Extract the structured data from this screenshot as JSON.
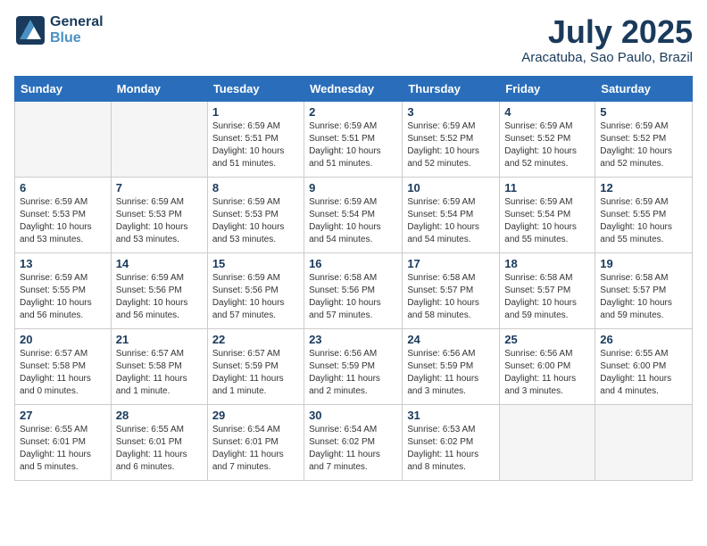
{
  "header": {
    "logo_general": "General",
    "logo_blue": "Blue",
    "month_title": "July 2025",
    "location": "Aracatuba, Sao Paulo, Brazil"
  },
  "weekdays": [
    "Sunday",
    "Monday",
    "Tuesday",
    "Wednesday",
    "Thursday",
    "Friday",
    "Saturday"
  ],
  "weeks": [
    [
      {
        "day": "",
        "info": ""
      },
      {
        "day": "",
        "info": ""
      },
      {
        "day": "1",
        "info": "Sunrise: 6:59 AM\nSunset: 5:51 PM\nDaylight: 10 hours\nand 51 minutes."
      },
      {
        "day": "2",
        "info": "Sunrise: 6:59 AM\nSunset: 5:51 PM\nDaylight: 10 hours\nand 51 minutes."
      },
      {
        "day": "3",
        "info": "Sunrise: 6:59 AM\nSunset: 5:52 PM\nDaylight: 10 hours\nand 52 minutes."
      },
      {
        "day": "4",
        "info": "Sunrise: 6:59 AM\nSunset: 5:52 PM\nDaylight: 10 hours\nand 52 minutes."
      },
      {
        "day": "5",
        "info": "Sunrise: 6:59 AM\nSunset: 5:52 PM\nDaylight: 10 hours\nand 52 minutes."
      }
    ],
    [
      {
        "day": "6",
        "info": "Sunrise: 6:59 AM\nSunset: 5:53 PM\nDaylight: 10 hours\nand 53 minutes."
      },
      {
        "day": "7",
        "info": "Sunrise: 6:59 AM\nSunset: 5:53 PM\nDaylight: 10 hours\nand 53 minutes."
      },
      {
        "day": "8",
        "info": "Sunrise: 6:59 AM\nSunset: 5:53 PM\nDaylight: 10 hours\nand 53 minutes."
      },
      {
        "day": "9",
        "info": "Sunrise: 6:59 AM\nSunset: 5:54 PM\nDaylight: 10 hours\nand 54 minutes."
      },
      {
        "day": "10",
        "info": "Sunrise: 6:59 AM\nSunset: 5:54 PM\nDaylight: 10 hours\nand 54 minutes."
      },
      {
        "day": "11",
        "info": "Sunrise: 6:59 AM\nSunset: 5:54 PM\nDaylight: 10 hours\nand 55 minutes."
      },
      {
        "day": "12",
        "info": "Sunrise: 6:59 AM\nSunset: 5:55 PM\nDaylight: 10 hours\nand 55 minutes."
      }
    ],
    [
      {
        "day": "13",
        "info": "Sunrise: 6:59 AM\nSunset: 5:55 PM\nDaylight: 10 hours\nand 56 minutes."
      },
      {
        "day": "14",
        "info": "Sunrise: 6:59 AM\nSunset: 5:56 PM\nDaylight: 10 hours\nand 56 minutes."
      },
      {
        "day": "15",
        "info": "Sunrise: 6:59 AM\nSunset: 5:56 PM\nDaylight: 10 hours\nand 57 minutes."
      },
      {
        "day": "16",
        "info": "Sunrise: 6:58 AM\nSunset: 5:56 PM\nDaylight: 10 hours\nand 57 minutes."
      },
      {
        "day": "17",
        "info": "Sunrise: 6:58 AM\nSunset: 5:57 PM\nDaylight: 10 hours\nand 58 minutes."
      },
      {
        "day": "18",
        "info": "Sunrise: 6:58 AM\nSunset: 5:57 PM\nDaylight: 10 hours\nand 59 minutes."
      },
      {
        "day": "19",
        "info": "Sunrise: 6:58 AM\nSunset: 5:57 PM\nDaylight: 10 hours\nand 59 minutes."
      }
    ],
    [
      {
        "day": "20",
        "info": "Sunrise: 6:57 AM\nSunset: 5:58 PM\nDaylight: 11 hours\nand 0 minutes."
      },
      {
        "day": "21",
        "info": "Sunrise: 6:57 AM\nSunset: 5:58 PM\nDaylight: 11 hours\nand 1 minute."
      },
      {
        "day": "22",
        "info": "Sunrise: 6:57 AM\nSunset: 5:59 PM\nDaylight: 11 hours\nand 1 minute."
      },
      {
        "day": "23",
        "info": "Sunrise: 6:56 AM\nSunset: 5:59 PM\nDaylight: 11 hours\nand 2 minutes."
      },
      {
        "day": "24",
        "info": "Sunrise: 6:56 AM\nSunset: 5:59 PM\nDaylight: 11 hours\nand 3 minutes."
      },
      {
        "day": "25",
        "info": "Sunrise: 6:56 AM\nSunset: 6:00 PM\nDaylight: 11 hours\nand 3 minutes."
      },
      {
        "day": "26",
        "info": "Sunrise: 6:55 AM\nSunset: 6:00 PM\nDaylight: 11 hours\nand 4 minutes."
      }
    ],
    [
      {
        "day": "27",
        "info": "Sunrise: 6:55 AM\nSunset: 6:01 PM\nDaylight: 11 hours\nand 5 minutes."
      },
      {
        "day": "28",
        "info": "Sunrise: 6:55 AM\nSunset: 6:01 PM\nDaylight: 11 hours\nand 6 minutes."
      },
      {
        "day": "29",
        "info": "Sunrise: 6:54 AM\nSunset: 6:01 PM\nDaylight: 11 hours\nand 7 minutes."
      },
      {
        "day": "30",
        "info": "Sunrise: 6:54 AM\nSunset: 6:02 PM\nDaylight: 11 hours\nand 7 minutes."
      },
      {
        "day": "31",
        "info": "Sunrise: 6:53 AM\nSunset: 6:02 PM\nDaylight: 11 hours\nand 8 minutes."
      },
      {
        "day": "",
        "info": ""
      },
      {
        "day": "",
        "info": ""
      }
    ]
  ]
}
